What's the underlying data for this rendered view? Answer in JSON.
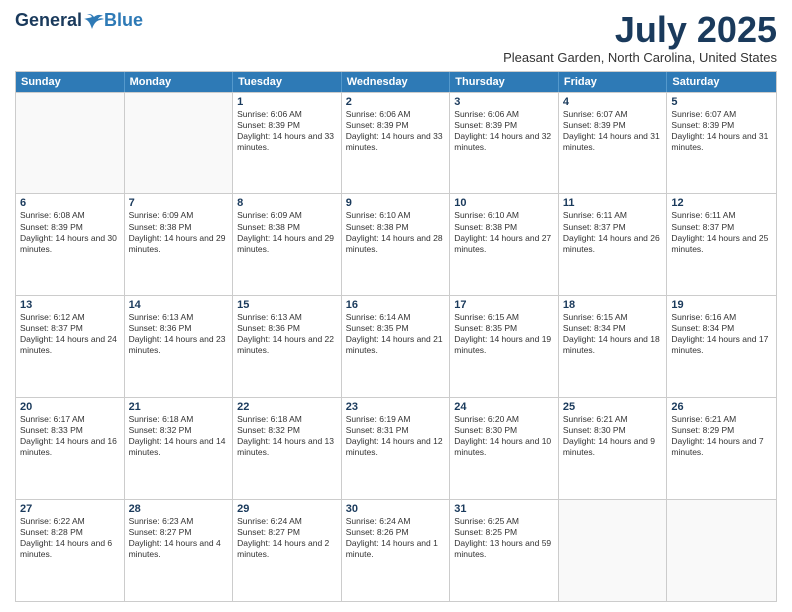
{
  "header": {
    "logo": {
      "general": "General",
      "blue": "Blue"
    },
    "title": "July 2025",
    "location": "Pleasant Garden, North Carolina, United States"
  },
  "calendar": {
    "days_of_week": [
      "Sunday",
      "Monday",
      "Tuesday",
      "Wednesday",
      "Thursday",
      "Friday",
      "Saturday"
    ],
    "rows": [
      [
        {
          "day": "",
          "info": ""
        },
        {
          "day": "",
          "info": ""
        },
        {
          "day": "1",
          "info": "Sunrise: 6:06 AM\nSunset: 8:39 PM\nDaylight: 14 hours and 33 minutes."
        },
        {
          "day": "2",
          "info": "Sunrise: 6:06 AM\nSunset: 8:39 PM\nDaylight: 14 hours and 33 minutes."
        },
        {
          "day": "3",
          "info": "Sunrise: 6:06 AM\nSunset: 8:39 PM\nDaylight: 14 hours and 32 minutes."
        },
        {
          "day": "4",
          "info": "Sunrise: 6:07 AM\nSunset: 8:39 PM\nDaylight: 14 hours and 31 minutes."
        },
        {
          "day": "5",
          "info": "Sunrise: 6:07 AM\nSunset: 8:39 PM\nDaylight: 14 hours and 31 minutes."
        }
      ],
      [
        {
          "day": "6",
          "info": "Sunrise: 6:08 AM\nSunset: 8:39 PM\nDaylight: 14 hours and 30 minutes."
        },
        {
          "day": "7",
          "info": "Sunrise: 6:09 AM\nSunset: 8:38 PM\nDaylight: 14 hours and 29 minutes."
        },
        {
          "day": "8",
          "info": "Sunrise: 6:09 AM\nSunset: 8:38 PM\nDaylight: 14 hours and 29 minutes."
        },
        {
          "day": "9",
          "info": "Sunrise: 6:10 AM\nSunset: 8:38 PM\nDaylight: 14 hours and 28 minutes."
        },
        {
          "day": "10",
          "info": "Sunrise: 6:10 AM\nSunset: 8:38 PM\nDaylight: 14 hours and 27 minutes."
        },
        {
          "day": "11",
          "info": "Sunrise: 6:11 AM\nSunset: 8:37 PM\nDaylight: 14 hours and 26 minutes."
        },
        {
          "day": "12",
          "info": "Sunrise: 6:11 AM\nSunset: 8:37 PM\nDaylight: 14 hours and 25 minutes."
        }
      ],
      [
        {
          "day": "13",
          "info": "Sunrise: 6:12 AM\nSunset: 8:37 PM\nDaylight: 14 hours and 24 minutes."
        },
        {
          "day": "14",
          "info": "Sunrise: 6:13 AM\nSunset: 8:36 PM\nDaylight: 14 hours and 23 minutes."
        },
        {
          "day": "15",
          "info": "Sunrise: 6:13 AM\nSunset: 8:36 PM\nDaylight: 14 hours and 22 minutes."
        },
        {
          "day": "16",
          "info": "Sunrise: 6:14 AM\nSunset: 8:35 PM\nDaylight: 14 hours and 21 minutes."
        },
        {
          "day": "17",
          "info": "Sunrise: 6:15 AM\nSunset: 8:35 PM\nDaylight: 14 hours and 19 minutes."
        },
        {
          "day": "18",
          "info": "Sunrise: 6:15 AM\nSunset: 8:34 PM\nDaylight: 14 hours and 18 minutes."
        },
        {
          "day": "19",
          "info": "Sunrise: 6:16 AM\nSunset: 8:34 PM\nDaylight: 14 hours and 17 minutes."
        }
      ],
      [
        {
          "day": "20",
          "info": "Sunrise: 6:17 AM\nSunset: 8:33 PM\nDaylight: 14 hours and 16 minutes."
        },
        {
          "day": "21",
          "info": "Sunrise: 6:18 AM\nSunset: 8:32 PM\nDaylight: 14 hours and 14 minutes."
        },
        {
          "day": "22",
          "info": "Sunrise: 6:18 AM\nSunset: 8:32 PM\nDaylight: 14 hours and 13 minutes."
        },
        {
          "day": "23",
          "info": "Sunrise: 6:19 AM\nSunset: 8:31 PM\nDaylight: 14 hours and 12 minutes."
        },
        {
          "day": "24",
          "info": "Sunrise: 6:20 AM\nSunset: 8:30 PM\nDaylight: 14 hours and 10 minutes."
        },
        {
          "day": "25",
          "info": "Sunrise: 6:21 AM\nSunset: 8:30 PM\nDaylight: 14 hours and 9 minutes."
        },
        {
          "day": "26",
          "info": "Sunrise: 6:21 AM\nSunset: 8:29 PM\nDaylight: 14 hours and 7 minutes."
        }
      ],
      [
        {
          "day": "27",
          "info": "Sunrise: 6:22 AM\nSunset: 8:28 PM\nDaylight: 14 hours and 6 minutes."
        },
        {
          "day": "28",
          "info": "Sunrise: 6:23 AM\nSunset: 8:27 PM\nDaylight: 14 hours and 4 minutes."
        },
        {
          "day": "29",
          "info": "Sunrise: 6:24 AM\nSunset: 8:27 PM\nDaylight: 14 hours and 2 minutes."
        },
        {
          "day": "30",
          "info": "Sunrise: 6:24 AM\nSunset: 8:26 PM\nDaylight: 14 hours and 1 minute."
        },
        {
          "day": "31",
          "info": "Sunrise: 6:25 AM\nSunset: 8:25 PM\nDaylight: 13 hours and 59 minutes."
        },
        {
          "day": "",
          "info": ""
        },
        {
          "day": "",
          "info": ""
        }
      ]
    ]
  }
}
